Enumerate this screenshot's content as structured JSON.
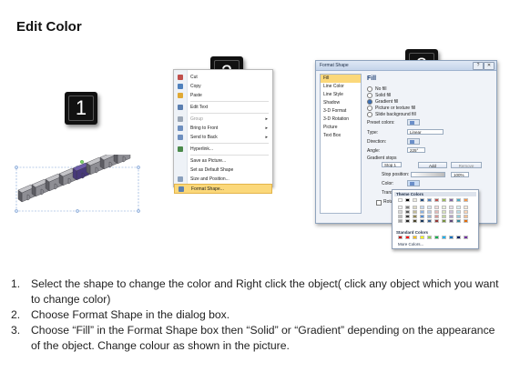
{
  "title": "Edit Color",
  "badges": [
    "1",
    "2",
    "3"
  ],
  "context_menu": {
    "items": [
      {
        "label": "Cut",
        "color": "#c0504d"
      },
      {
        "label": "Copy",
        "color": "#4f81bd"
      },
      {
        "label": "Paste",
        "color": "#e0a935"
      },
      {
        "label": "Edit Text",
        "color": "#5a7fb0"
      },
      {
        "label": "Group",
        "color": "#9aa6b5"
      },
      {
        "label": "Bring to Front",
        "color": "#6d8fbf"
      },
      {
        "label": "Send to Back",
        "color": "#6d8fbf"
      },
      {
        "label": "Hyperlink...",
        "color": "#4a8a4a"
      },
      {
        "label": "Save as Picture...",
        "color": "#ffffff"
      },
      {
        "label": "Set as Default Shape",
        "color": "#ffffff"
      },
      {
        "label": "Size and Position...",
        "color": "#8aa0bd"
      },
      {
        "label": "Format Shape...",
        "color": "#5a7fb0"
      }
    ]
  },
  "dialog": {
    "title": "Format Shape",
    "categories": [
      "Fill",
      "Line Color",
      "Line Style",
      "Shadow",
      "3-D Format",
      "3-D Rotation",
      "Picture",
      "Text Box"
    ],
    "fill_heading": "Fill",
    "fill_options": [
      "No fill",
      "Solid fill",
      "Gradient fill",
      "Picture or texture fill",
      "Slide background fill"
    ],
    "fields": {
      "preset_colors": "Preset colors:",
      "type_label": "Type:",
      "type_value": "Linear",
      "direction_label": "Direction:",
      "angle_label": "Angle:",
      "angle_value": "225°",
      "gradient_stops": "Gradient stops",
      "stop_value": "Stop 1",
      "add": "Add",
      "remove": "Remove",
      "stop_position": "Stop position:",
      "stop_position_value": "100%",
      "color_label": "Color:",
      "transparency_label": "Transpa",
      "rotate_label": "Rotate"
    }
  },
  "palette": {
    "theme_heading": "Theme Colors",
    "standard_heading": "Standard Colors",
    "more": "More Colors...",
    "theme_top": [
      "#ffffff",
      "#000000",
      "#eeece1",
      "#1f497d",
      "#4f81bd",
      "#c0504d",
      "#9bbb59",
      "#8064a2",
      "#4bacc6",
      "#f79646"
    ],
    "theme_shade_1": [
      "#f2f2f2",
      "#7f7f7f",
      "#ddd9c3",
      "#c6d9f0",
      "#dbe5f1",
      "#f2dcdb",
      "#ebf1dd",
      "#e5e0ec",
      "#dbeef3",
      "#fdeada"
    ],
    "theme_shade_2": [
      "#d8d8d8",
      "#595959",
      "#c4bd97",
      "#8db3e2",
      "#b8cce4",
      "#e5b9b7",
      "#d7e3bc",
      "#ccc1d9",
      "#b7dde8",
      "#fbd5b5"
    ],
    "theme_shade_3": [
      "#bfbfbf",
      "#3f3f3f",
      "#938953",
      "#548dd4",
      "#95b3d7",
      "#d99694",
      "#c3d69b",
      "#b2a2c7",
      "#92cddc",
      "#fac08f"
    ],
    "theme_shade_4": [
      "#a5a5a5",
      "#262626",
      "#494429",
      "#17365d",
      "#366092",
      "#953734",
      "#76923c",
      "#5f497a",
      "#31859b",
      "#e36c09"
    ],
    "standard": [
      "#c00000",
      "#ff0000",
      "#ffc000",
      "#ffff00",
      "#92d050",
      "#00b050",
      "#00b0f0",
      "#0070c0",
      "#002060",
      "#7030a0"
    ]
  },
  "shape": {
    "colors": {
      "gray": "#8e8e94",
      "gray_dark": "#5d5d63",
      "gray_light": "#c4c4c8",
      "purple": "#6d5ba8",
      "purple_dark": "#47397a"
    }
  },
  "instructions": [
    {
      "num": "1.",
      "text": "Select the shape to change the color and Right click the object( click any object which you want to change color)"
    },
    {
      "num": "2.",
      "text": "Choose Format Shape in the dialog box."
    },
    {
      "num": "3.",
      "text": "Choose “Fill” in the Format Shape box then “Solid” or “Gradient” depending on the appearance of the object. Change colour as shown in the picture."
    }
  ]
}
